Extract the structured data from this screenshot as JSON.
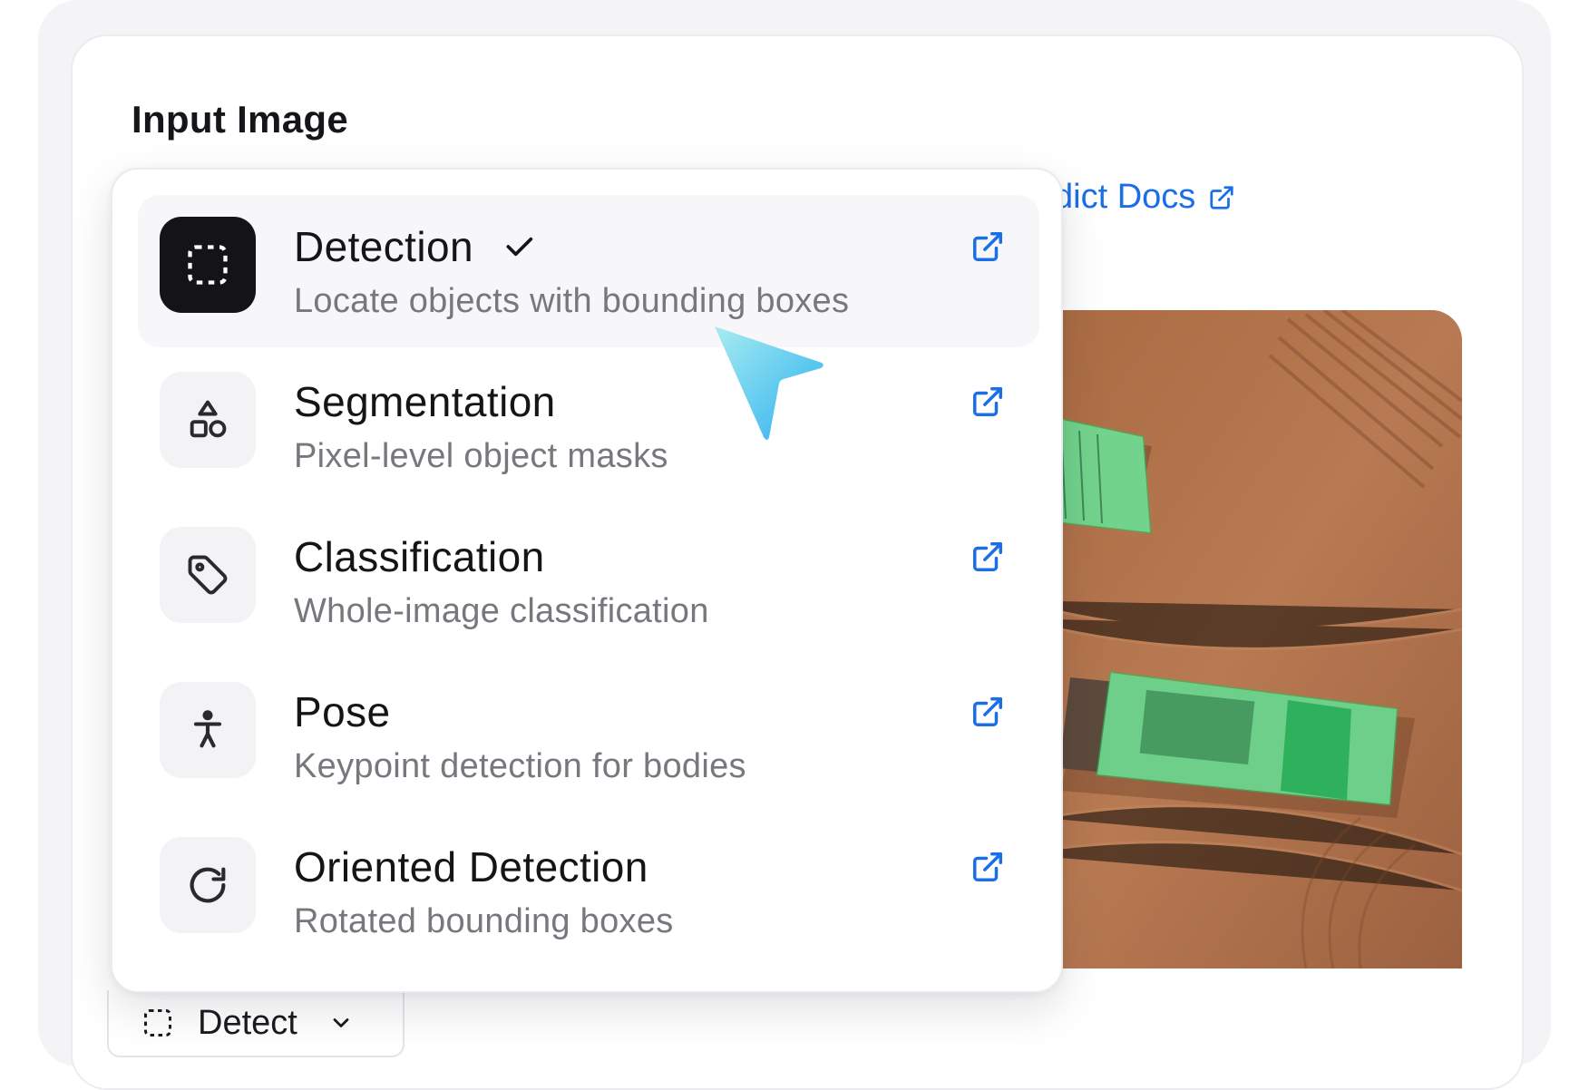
{
  "section": {
    "title": "Input Image"
  },
  "docs_link": {
    "label": "dict Docs",
    "icon": "external-link-icon",
    "color": "#1a6fe8"
  },
  "model_select": {
    "label": "Detect",
    "icon": "dashed-square-icon",
    "chevron": "chevron-down-icon"
  },
  "dropdown": {
    "items": [
      {
        "title": "Detection",
        "description": "Locate objects with bounding boxes",
        "icon": "dashed-square-icon",
        "selected": true
      },
      {
        "title": "Segmentation",
        "description": "Pixel-level object masks",
        "icon": "shapes-icon",
        "selected": false
      },
      {
        "title": "Classification",
        "description": "Whole-image classification",
        "icon": "tag-icon",
        "selected": false
      },
      {
        "title": "Pose",
        "description": "Keypoint detection for bodies",
        "icon": "person-icon",
        "selected": false
      },
      {
        "title": "Oriented Detection",
        "description": "Rotated bounding boxes",
        "icon": "rotate-icon",
        "selected": false
      }
    ]
  },
  "colors": {
    "accent": "#1a6fe8",
    "mask": "#22c55e",
    "selected_tile": "#141416"
  }
}
